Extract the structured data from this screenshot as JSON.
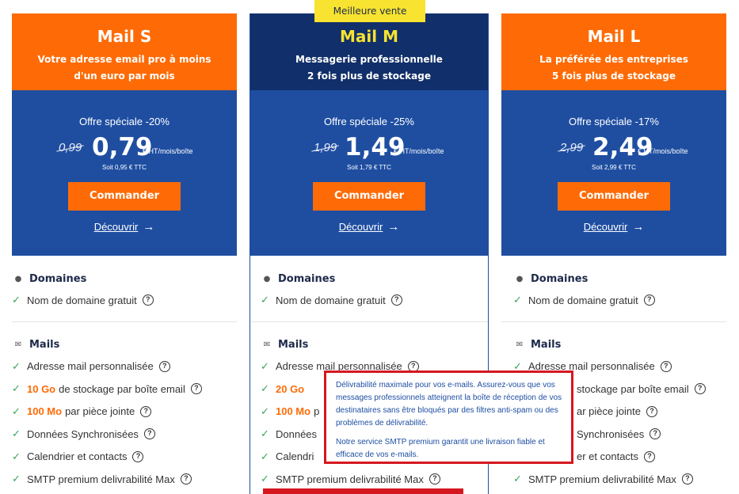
{
  "plans": [
    {
      "name": "Mail S",
      "subtitle_1": "Votre adresse email pro à moins",
      "subtitle_2": "d'un euro par mois",
      "offer": "Offre spéciale -20%",
      "old_price": "0,99",
      "new_price": "0,79",
      "unit": "€ HT/mois/boîte",
      "ttc": "Soit 0,95 € TTC",
      "order_label": "Commander",
      "discover_label": "Découvrir",
      "storage": "10 Go",
      "attachment": "100 Mo"
    },
    {
      "name": "Mail M",
      "badge": "Meilleure vente",
      "subtitle_1": "Messagerie professionnelle",
      "subtitle_2": "2 fois plus de stockage",
      "offer": "Offre spéciale -25%",
      "old_price": "1,99",
      "new_price": "1,49",
      "unit": "€ HT/mois/boîte",
      "ttc": "Soit 1,79 € TTC",
      "order_label": "Commander",
      "discover_label": "Découvrir",
      "storage": "20 Go",
      "attachment": "100 Mo"
    },
    {
      "name": "Mail L",
      "subtitle_1": "La préférée des entreprises",
      "subtitle_2": "5 fois plus de stockage",
      "offer": "Offre spéciale -17%",
      "old_price": "2,99",
      "new_price": "2,49",
      "unit": "€ HT/mois/boîte",
      "ttc": "Soit 2,99 € TTC",
      "order_label": "Commander",
      "discover_label": "Découvrir",
      "storage": "",
      "attachment": ""
    }
  ],
  "features": {
    "domains_title": "Domaines",
    "free_domain": "Nom de domaine gratuit",
    "mails_title": "Mails",
    "custom_address": "Adresse mail personnalisée",
    "storage_suffix": "de stockage par boîte email",
    "attachment_suffix": "par pièce jointe",
    "sync": "Données Synchronisées",
    "calendar": "Calendrier et contacts",
    "smtp": "SMTP premium delivrabilité Max"
  },
  "partial": {
    "m_custom_address": "Adresse mail personnalisée",
    "m_attachment_suffix": "p",
    "m_sync": "Données",
    "m_calendar": "Calendri",
    "l_custom_address": "Adresse mail personnalisée",
    "l_storage": "stockage par boîte email",
    "l_attachment": "ar pièce jointe",
    "l_sync": "Synchronisées",
    "l_calendar": "er et contacts"
  },
  "tooltip": {
    "paragraph_1": "Délivrabilité maximale pour vos e-mails. Assurez-vous que vos messages professionnels atteignent la boîte de réception de vos destinataires sans être bloqués par des filtres anti-spam ou des problèmes de délivrabilité.",
    "paragraph_2": "Notre service SMTP premium garantit une livraison fiable et efficace de vos e-mails."
  },
  "colors": {
    "orange": "#fe6b06",
    "navy": "#112f6a",
    "blue": "#1f4ea1",
    "yellow": "#f7e330",
    "green": "#3aa55a",
    "red": "#d51720"
  },
  "icons": {
    "domains": "globe-icon",
    "mails": "envelope-icon",
    "check": "check-icon",
    "help": "question-circle-icon",
    "arrow": "arrow-right-icon"
  }
}
